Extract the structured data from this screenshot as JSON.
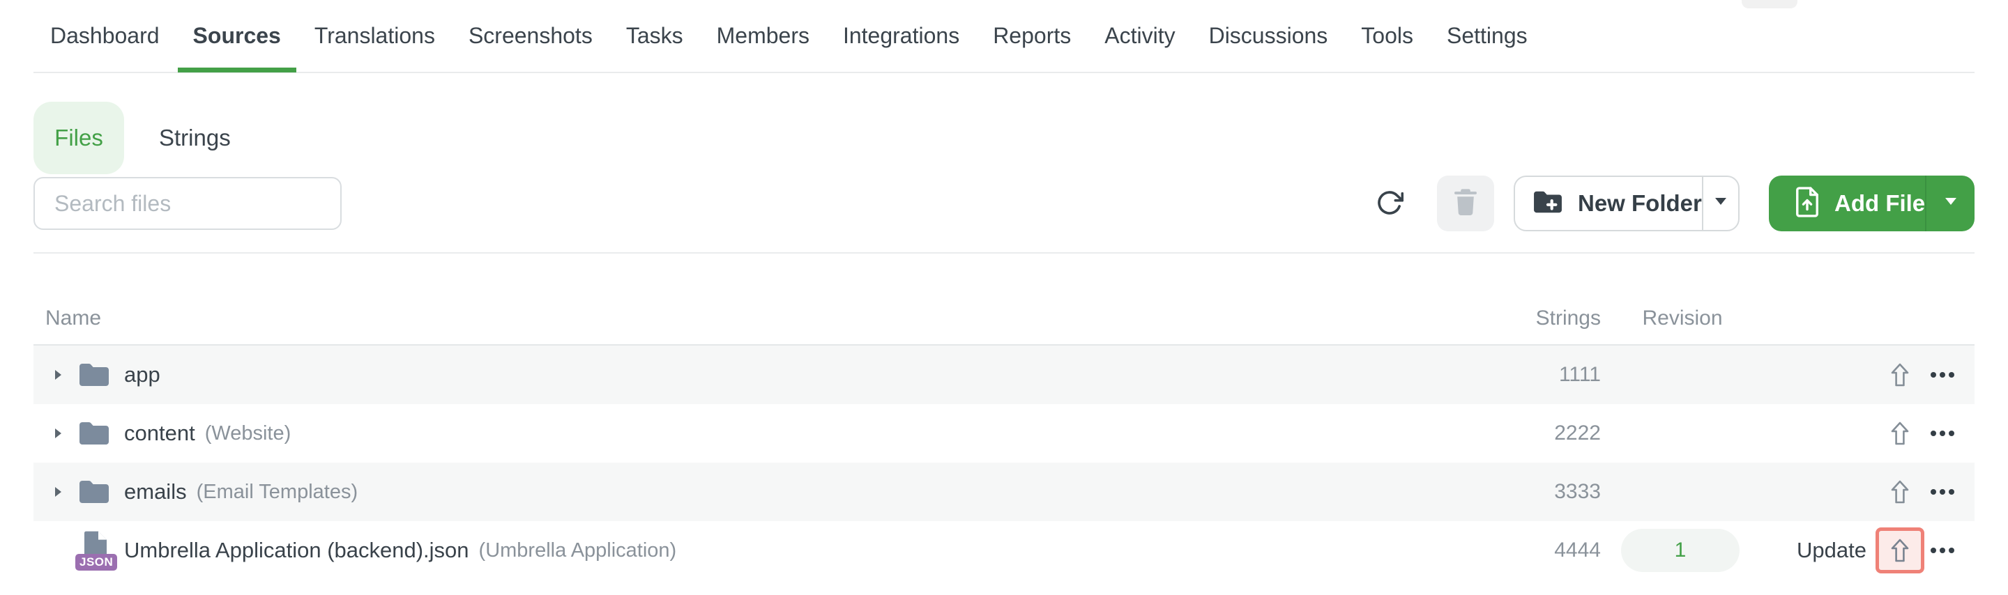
{
  "nav": {
    "items": [
      "Dashboard",
      "Sources",
      "Translations",
      "Screenshots",
      "Tasks",
      "Members",
      "Integrations",
      "Reports",
      "Activity",
      "Discussions",
      "Tools",
      "Settings"
    ],
    "active_item": "Sources"
  },
  "view_toggle": {
    "files_label": "Files",
    "strings_label": "Strings",
    "active": "Files"
  },
  "toolbar": {
    "search_placeholder": "Search files",
    "new_folder_label": "New Folder",
    "add_file_label": "Add File"
  },
  "table": {
    "headers": {
      "name": "Name",
      "strings": "Strings",
      "revision": "Revision"
    },
    "rows": [
      {
        "kind": "folder",
        "name": "app",
        "note": "",
        "strings": "1111",
        "revision": "",
        "action": ""
      },
      {
        "kind": "folder",
        "name": "content",
        "note": "(Website)",
        "strings": "2222",
        "revision": "",
        "action": ""
      },
      {
        "kind": "folder",
        "name": "emails",
        "note": "(Email Templates)",
        "strings": "3333",
        "revision": "",
        "action": ""
      },
      {
        "kind": "file",
        "file_badge": "JSON",
        "name": "Umbrella Application (backend).json",
        "note": "(Umbrella Application)",
        "strings": "4444",
        "revision": "1",
        "action": "Update",
        "upload_highlighted": true
      }
    ]
  },
  "colors": {
    "accent_green": "#43a047",
    "toggle_bg_green": "#e9f5ea",
    "row_stripe": "#f6f7f7",
    "highlight_border_red": "#ef8177",
    "highlight_bg_pink": "#fcebe9",
    "json_badge_purple": "#9b6fb0",
    "muted_text": "#8a929a"
  }
}
